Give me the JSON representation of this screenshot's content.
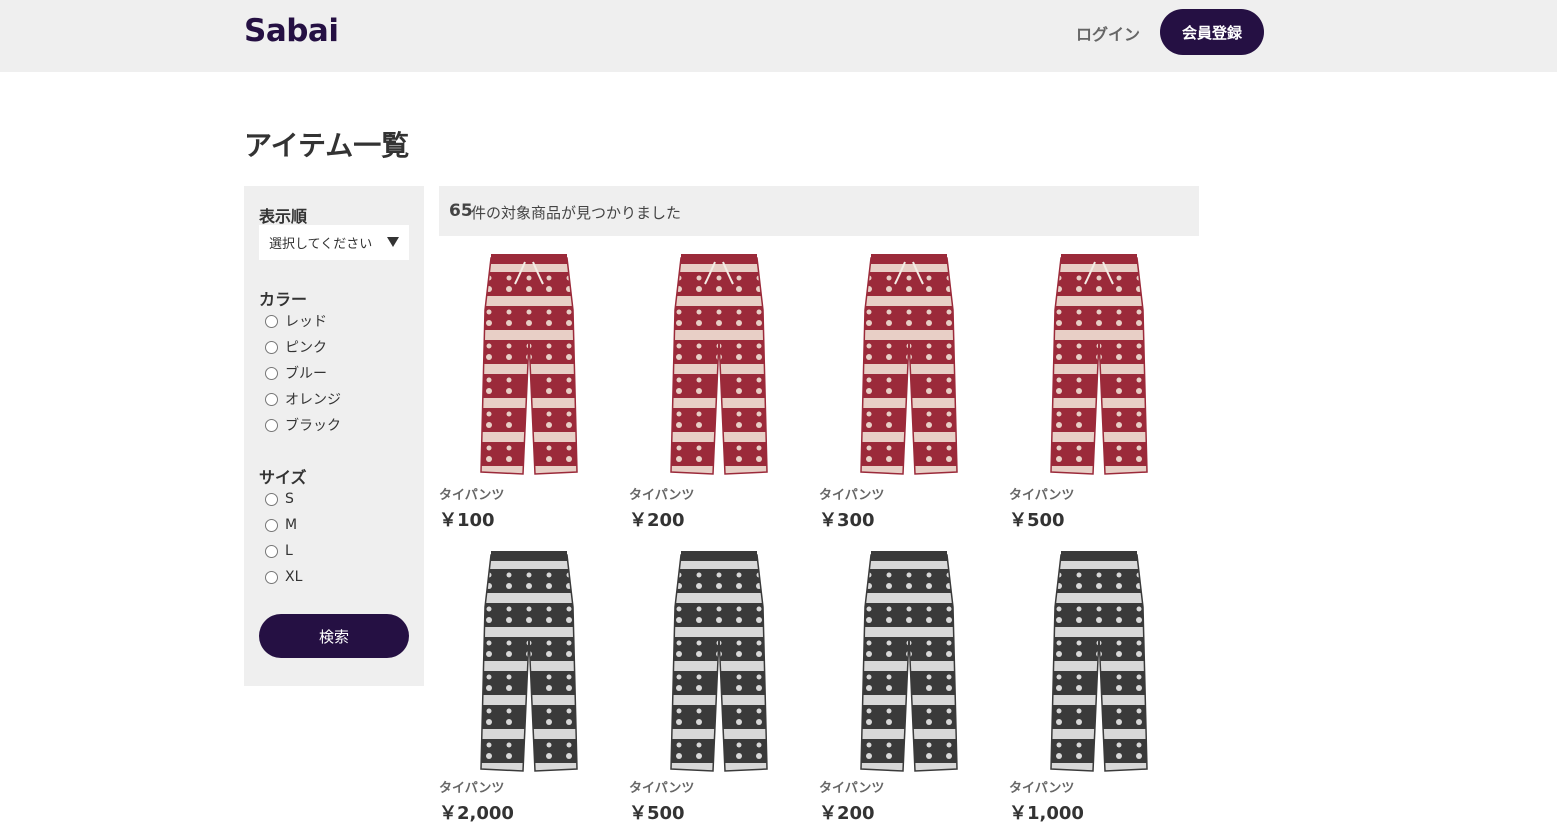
{
  "header": {
    "logo": "Sabai",
    "login_label": "ログイン",
    "signup_label": "会員登録"
  },
  "page_title": "アイテム一覧",
  "sidebar": {
    "sort_heading": "表示順",
    "sort_placeholder": "選択してください",
    "color_heading": "カラー",
    "colors": [
      "レッド",
      "ピンク",
      "ブルー",
      "オレンジ",
      "ブラック"
    ],
    "size_heading": "サイズ",
    "sizes": [
      "S",
      "M",
      "L",
      "XL"
    ],
    "search_label": "検索"
  },
  "results": {
    "count": "65",
    "text": "件の対象商品が見つかりました"
  },
  "products": [
    {
      "name": "タイパンツ",
      "price": "￥100",
      "pattern": "red"
    },
    {
      "name": "タイパンツ",
      "price": "￥200",
      "pattern": "red"
    },
    {
      "name": "タイパンツ",
      "price": "￥300",
      "pattern": "red"
    },
    {
      "name": "タイパンツ",
      "price": "￥500",
      "pattern": "red"
    },
    {
      "name": "タイパンツ",
      "price": "￥2,000",
      "pattern": "gray"
    },
    {
      "name": "タイパンツ",
      "price": "￥500",
      "pattern": "gray"
    },
    {
      "name": "タイパンツ",
      "price": "￥200",
      "pattern": "gray"
    },
    {
      "name": "タイパンツ",
      "price": "￥1,000",
      "pattern": "gray"
    }
  ],
  "colors": {
    "brand": "#251043",
    "panel": "#efefef",
    "pants_red": "#9b2a3a",
    "pants_red_light": "#e8cfc6",
    "pants_gray": "#3a3a3a",
    "pants_gray_light": "#d8d8d8"
  }
}
